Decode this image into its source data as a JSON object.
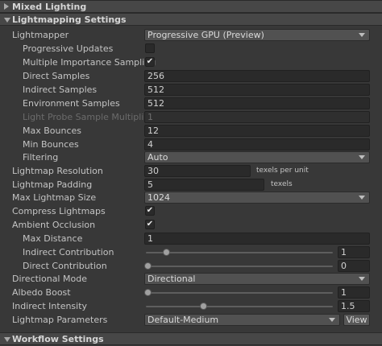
{
  "sections": {
    "mixed_lighting": "Mixed Lighting",
    "lightmapping_settings": "Lightmapping Settings",
    "workflow_settings": "Workflow Settings"
  },
  "lightmapper": {
    "label": "Lightmapper",
    "value": "Progressive GPU (Preview)"
  },
  "progressive_updates": {
    "label": "Progressive Updates",
    "checked": false
  },
  "mis": {
    "label": "Multiple Importance Sampling",
    "checked": true
  },
  "direct_samples": {
    "label": "Direct Samples",
    "value": "256"
  },
  "indirect_samples": {
    "label": "Indirect Samples",
    "value": "512"
  },
  "environment_samples": {
    "label": "Environment Samples",
    "value": "512"
  },
  "light_probe_multiplier": {
    "label": "Light Probe Sample Multiplier",
    "value": "1"
  },
  "max_bounces": {
    "label": "Max Bounces",
    "value": "12"
  },
  "min_bounces": {
    "label": "Min Bounces",
    "value": "4"
  },
  "filtering": {
    "label": "Filtering",
    "value": "Auto"
  },
  "lightmap_resolution": {
    "label": "Lightmap Resolution",
    "value": "30",
    "unit": "texels per unit"
  },
  "lightmap_padding": {
    "label": "Lightmap Padding",
    "value": "5",
    "unit": "texels"
  },
  "max_lightmap_size": {
    "label": "Max Lightmap Size",
    "value": "1024"
  },
  "compress_lightmaps": {
    "label": "Compress Lightmaps",
    "checked": true
  },
  "ambient_occlusion": {
    "label": "Ambient Occlusion",
    "checked": true
  },
  "max_distance": {
    "label": "Max Distance",
    "value": "1"
  },
  "indirect_contribution": {
    "label": "Indirect Contribution",
    "value": "1",
    "fraction": 0.1
  },
  "direct_contribution": {
    "label": "Direct Contribution",
    "value": "0",
    "fraction": 0.0
  },
  "directional_mode": {
    "label": "Directional Mode",
    "value": "Directional"
  },
  "albedo_boost": {
    "label": "Albedo Boost",
    "value": "1",
    "fraction": 0.0
  },
  "indirect_intensity": {
    "label": "Indirect Intensity",
    "value": "1.5",
    "fraction": 0.3
  },
  "lightmap_parameters": {
    "label": "Lightmap Parameters",
    "value": "Default-Medium",
    "button": "View"
  },
  "icons": {
    "expand": "triangle-right-icon",
    "collapse": "triangle-down-icon",
    "check": "✔"
  }
}
